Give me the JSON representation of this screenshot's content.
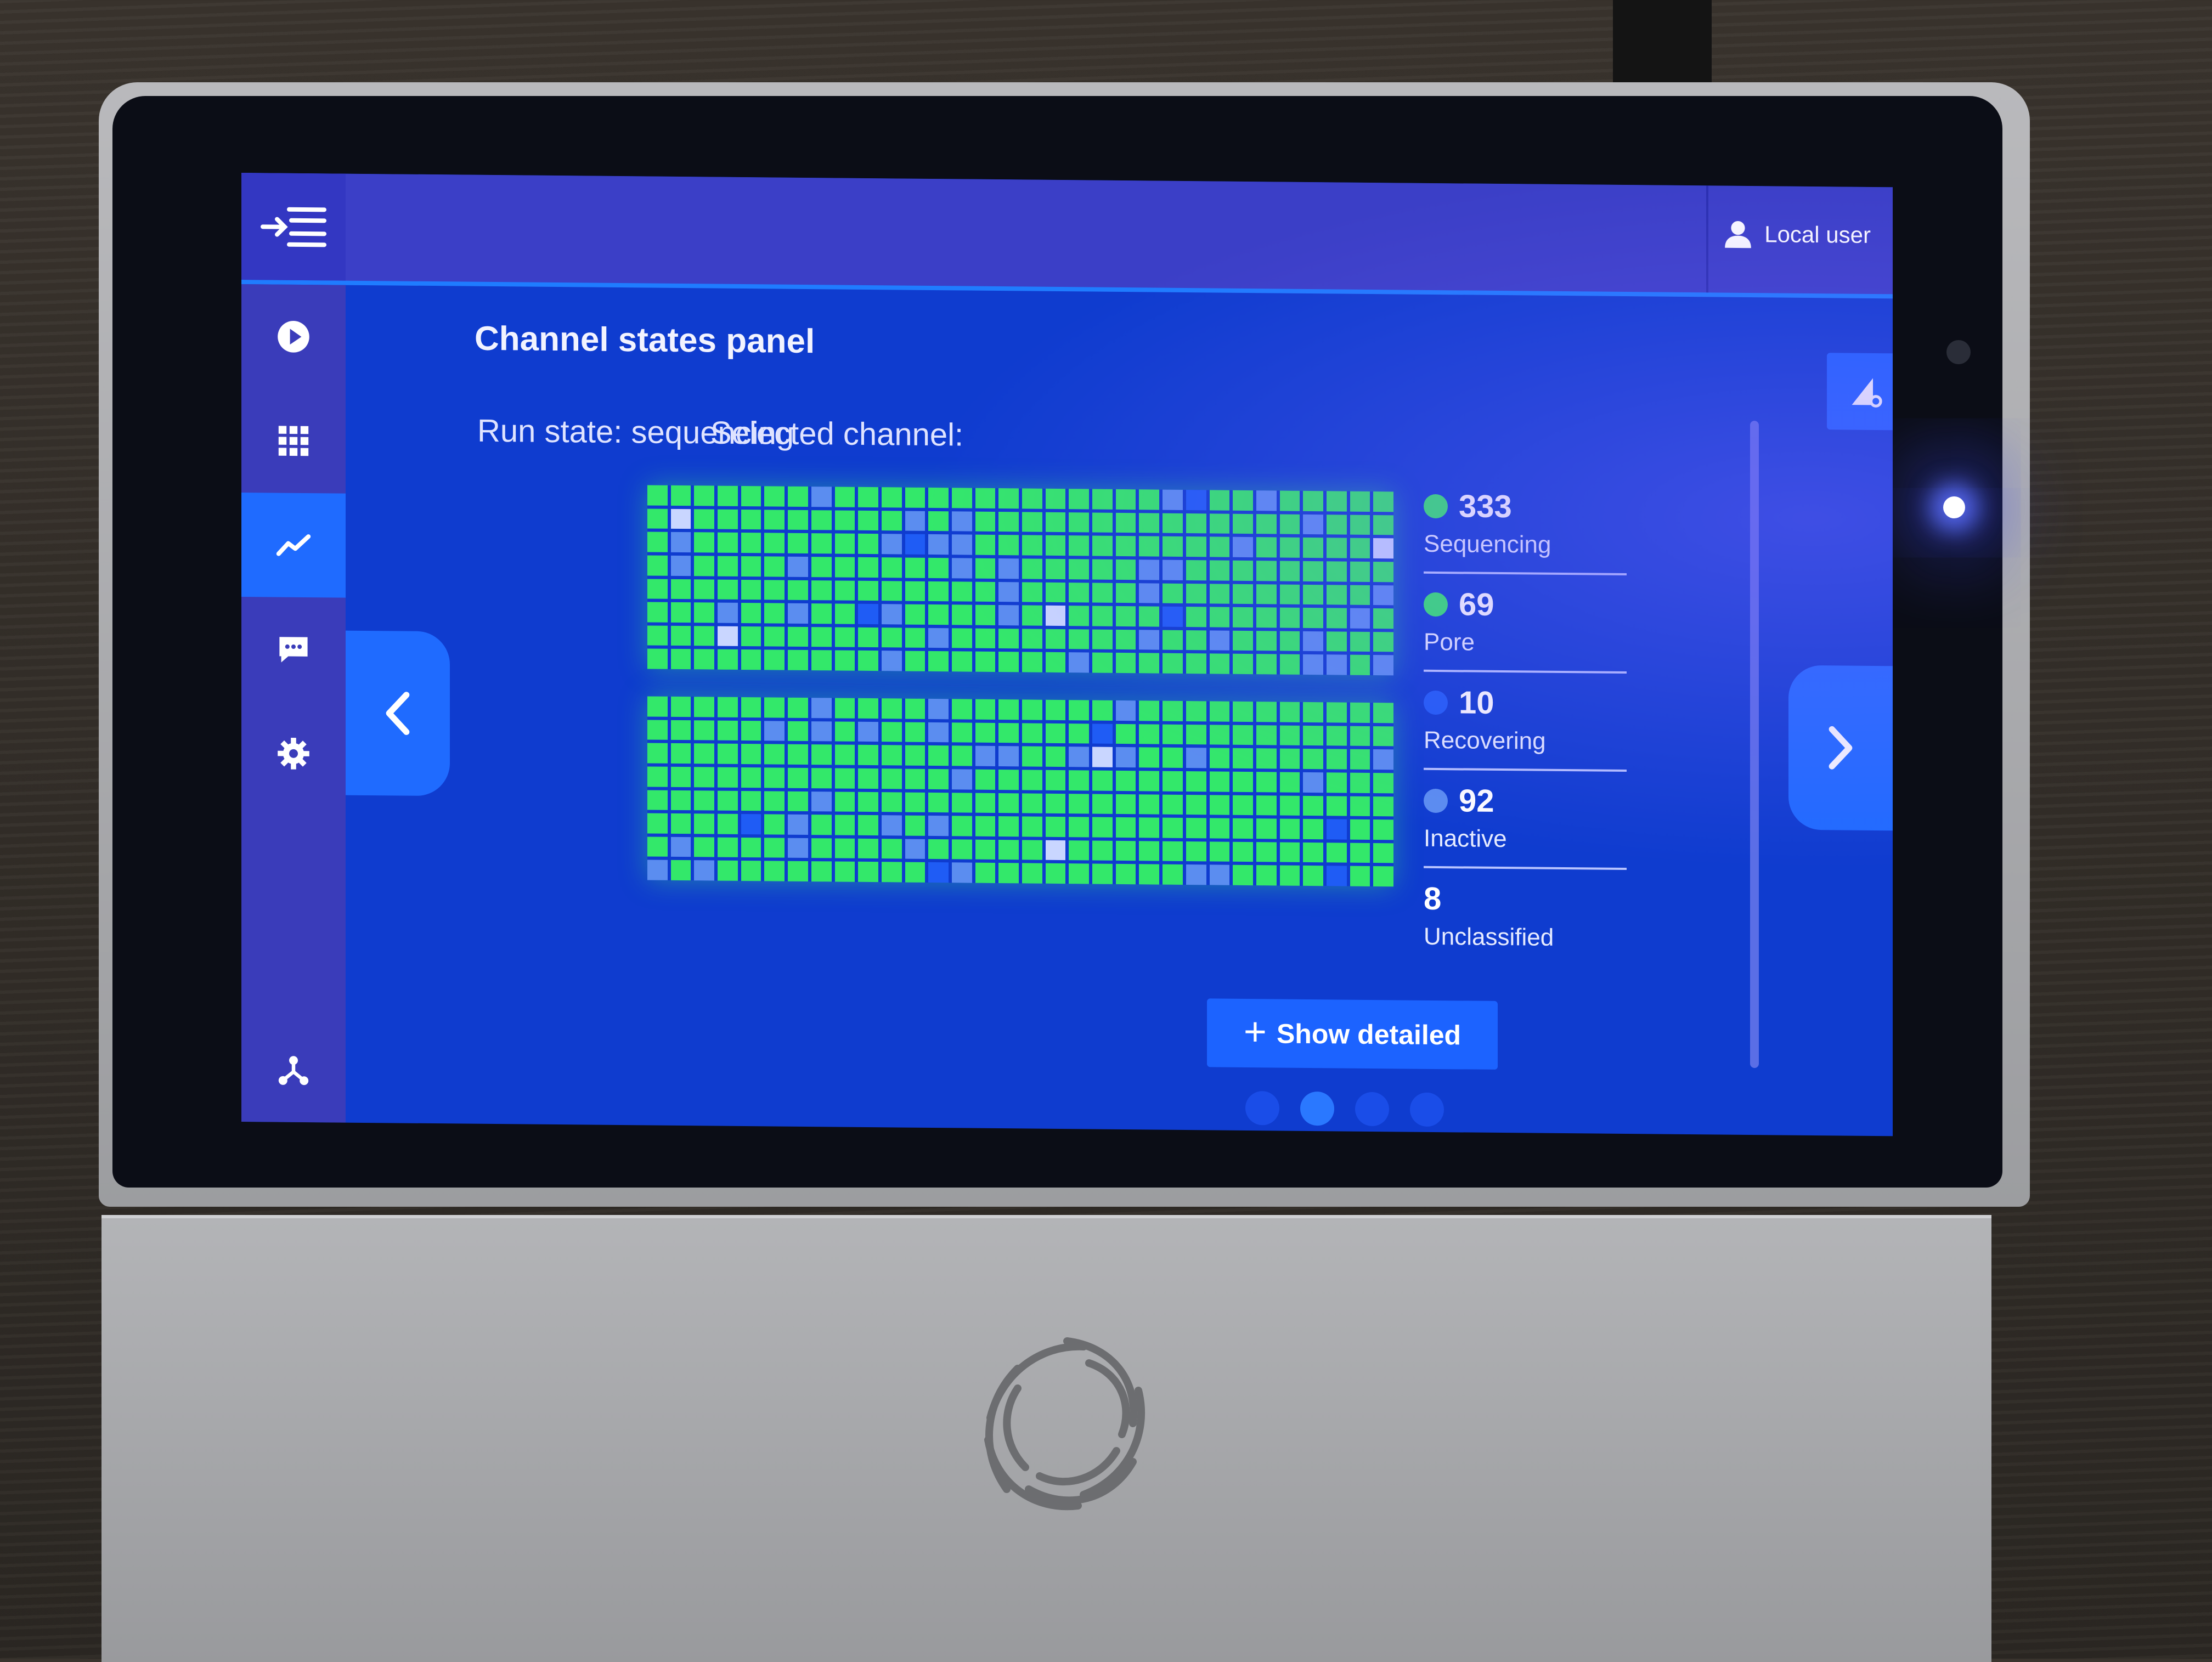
{
  "header": {
    "user_label": "Local user"
  },
  "sidebar": {
    "items": [
      {
        "icon": "play-circle-icon"
      },
      {
        "icon": "grid-icon"
      },
      {
        "icon": "trend-chart-icon",
        "active": true
      },
      {
        "icon": "message-icon"
      },
      {
        "icon": "gear-icon"
      },
      {
        "icon": "network-icon"
      }
    ]
  },
  "panel": {
    "title": "Channel states panel",
    "run_state": "Run state: sequencing",
    "selected_channel": "Selected channel:",
    "show_detailed_label": "Show detailed",
    "page_indicator": {
      "pages": 4,
      "current": 2
    }
  },
  "legend": [
    {
      "count": "333",
      "label": "Sequencing",
      "color": "#33e86a"
    },
    {
      "count": "69",
      "label": "Pore",
      "color": "#33e86a"
    },
    {
      "count": "10",
      "label": "Recovering",
      "color": "#1f5cf5"
    },
    {
      "count": "92",
      "label": "Inactive",
      "color": "#5b8df0"
    },
    {
      "count": "8",
      "label": "Unclassified",
      "color": ""
    }
  ],
  "colors": {
    "screen_bg": "#0f3ccf",
    "accent": "#1c63ff",
    "sequencing": "#33e86a",
    "inactive": "#5b8df0",
    "recovering": "#1f5cf5",
    "unclassified": "#c9d6ff"
  }
}
